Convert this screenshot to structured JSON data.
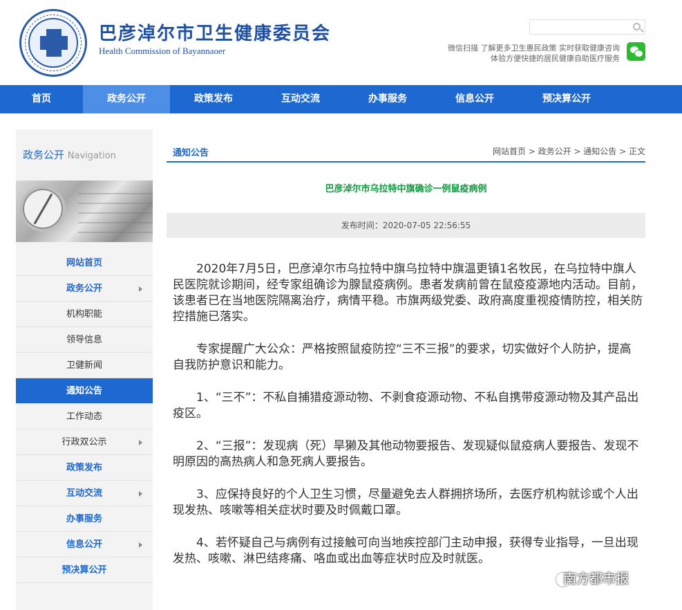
{
  "header": {
    "title": "巴彦淖尔市卫生健康委员会",
    "subtitle": "Health Commission of Bayannaoer",
    "search_placeholder": "",
    "wechat_line1": "微信扫描 了解更多卫生惠民政策 实时获取健康咨询",
    "wechat_line2": "体验方便快捷的居民健康自助医疗服务",
    "wechat_icon": "wechat-icon"
  },
  "nav": {
    "items": [
      {
        "label": "首页"
      },
      {
        "label": "政务公开"
      },
      {
        "label": "政策发布"
      },
      {
        "label": "互动交流"
      },
      {
        "label": "办事服务"
      },
      {
        "label": "信息公开"
      },
      {
        "label": "预决算公开"
      }
    ],
    "active_index": 1
  },
  "sidebar": {
    "heading": "政务公开",
    "heading_en": "Navigation",
    "items": [
      {
        "label": "网站首页"
      },
      {
        "label": "政务公开"
      },
      {
        "label": "机构职能"
      },
      {
        "label": "领导信息"
      },
      {
        "label": "卫健新闻"
      },
      {
        "label": "通知公告"
      },
      {
        "label": "工作动态"
      },
      {
        "label": "行政双公示"
      },
      {
        "label": "政策发布"
      },
      {
        "label": "互动交流"
      },
      {
        "label": "办事服务"
      },
      {
        "label": "信息公开"
      },
      {
        "label": "预决算公开"
      }
    ]
  },
  "main": {
    "section_title": "通知公告",
    "breadcrumb": "网站首页 > 政务公开 > 通知公告 > 正文",
    "article_title": "巴彦淖尔市乌拉特中旗确诊一例鼠疫病例",
    "publish_time": "发布时间：2020-07-05 22:56:55",
    "paragraphs": [
      "2020年7月5日，巴彦淖尔市乌拉特中旗乌拉特中旗温更镇1名牧民，在乌拉特中旗人民医院就诊期间，经专家组确诊为腺鼠疫病例。患者发病前曾在鼠疫疫源地内活动。目前，该患者已在当地医院隔离治疗，病情平稳。市旗两级党委、政府高度重视疫情防控，相关防控措施已落实。",
      "专家提醒广大公众：严格按照鼠疫防控“三不三报”的要求，切实做好个人防护，提高自我防护意识和能力。",
      "1、“三不”：不私自捕猎疫源动物、不剥食疫源动物、不私自携带疫源动物及其产品出疫区。",
      "2、“三报”：发现病（死）旱獭及其他动物要报告、发现疑似鼠疫病人要报告、发现不明原因的高热病人和急死病人要报告。",
      "3、应保持良好的个人卫生习惯，尽量避免去人群拥挤场所，去医疗机构就诊或个人出现发热、咳嗽等相关症状时要及时佩戴口罩。",
      "4、若怀疑自己与病例有过接触可向当地疾控部门主动申报，获得专业指导，一旦出现发热、咳嗽、淋巴结疼痛、咯血或出血等症状时应及时就医。"
    ]
  },
  "watermark": "南方都市报"
}
